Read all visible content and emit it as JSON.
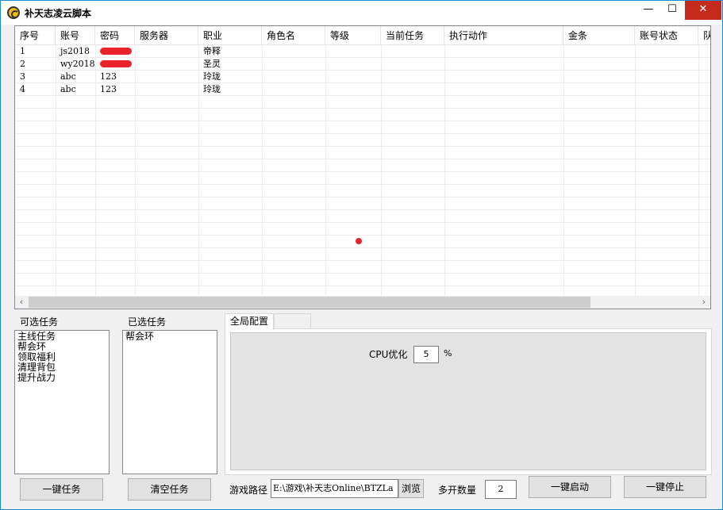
{
  "window": {
    "title": "补天志凌云脚本",
    "minimize_label": "—",
    "maximize_label": "☐",
    "close_label": "✕"
  },
  "table": {
    "columns": [
      "序号",
      "账号",
      "密码",
      "服务器",
      "职业",
      "角色名",
      "等级",
      "当前任务",
      "执行动作",
      "金条",
      "账号状态",
      "队"
    ],
    "rows": [
      {
        "no": "1",
        "account": "js2018",
        "password": "",
        "server": "",
        "job": "帝释",
        "redacted": true
      },
      {
        "no": "2",
        "account": "wy2018",
        "password": "",
        "server": "",
        "job": "圣灵",
        "redacted": true
      },
      {
        "no": "3",
        "account": "abc",
        "password": "123",
        "server": "",
        "job": "玲珑",
        "redacted": false
      },
      {
        "no": "4",
        "account": "abc",
        "password": "123",
        "server": "",
        "job": "玲珑",
        "redacted": false
      }
    ],
    "scroll_left": "‹",
    "scroll_right": "›"
  },
  "available_tasks": {
    "label": "可选任务",
    "items": [
      "主线任务",
      "帮会环",
      "领取福利",
      "清理背包",
      "提升战力"
    ]
  },
  "selected_tasks": {
    "label": "已选任务",
    "items": [
      "帮会环"
    ]
  },
  "tabs": [
    {
      "label": "全局配置",
      "active": true
    },
    {
      "label": "",
      "active": false
    }
  ],
  "global_config": {
    "cpu_label": "CPU优化",
    "cpu_value": "5",
    "cpu_unit": "%"
  },
  "bottom": {
    "one_key_task": "一键任务",
    "clear_task": "清空任务",
    "game_path_label": "游戏路径",
    "game_path_value": "E:\\游戏\\补天志Online\\BTZLa",
    "browse": "浏览",
    "multi_count_label": "多开数量",
    "multi_count_value": "2",
    "one_key_start": "一键启动",
    "one_key_stop": "一键停止"
  },
  "colors": {
    "accent": "#0078d7",
    "close_red": "#c42b1c",
    "redaction": "#e8242a"
  }
}
